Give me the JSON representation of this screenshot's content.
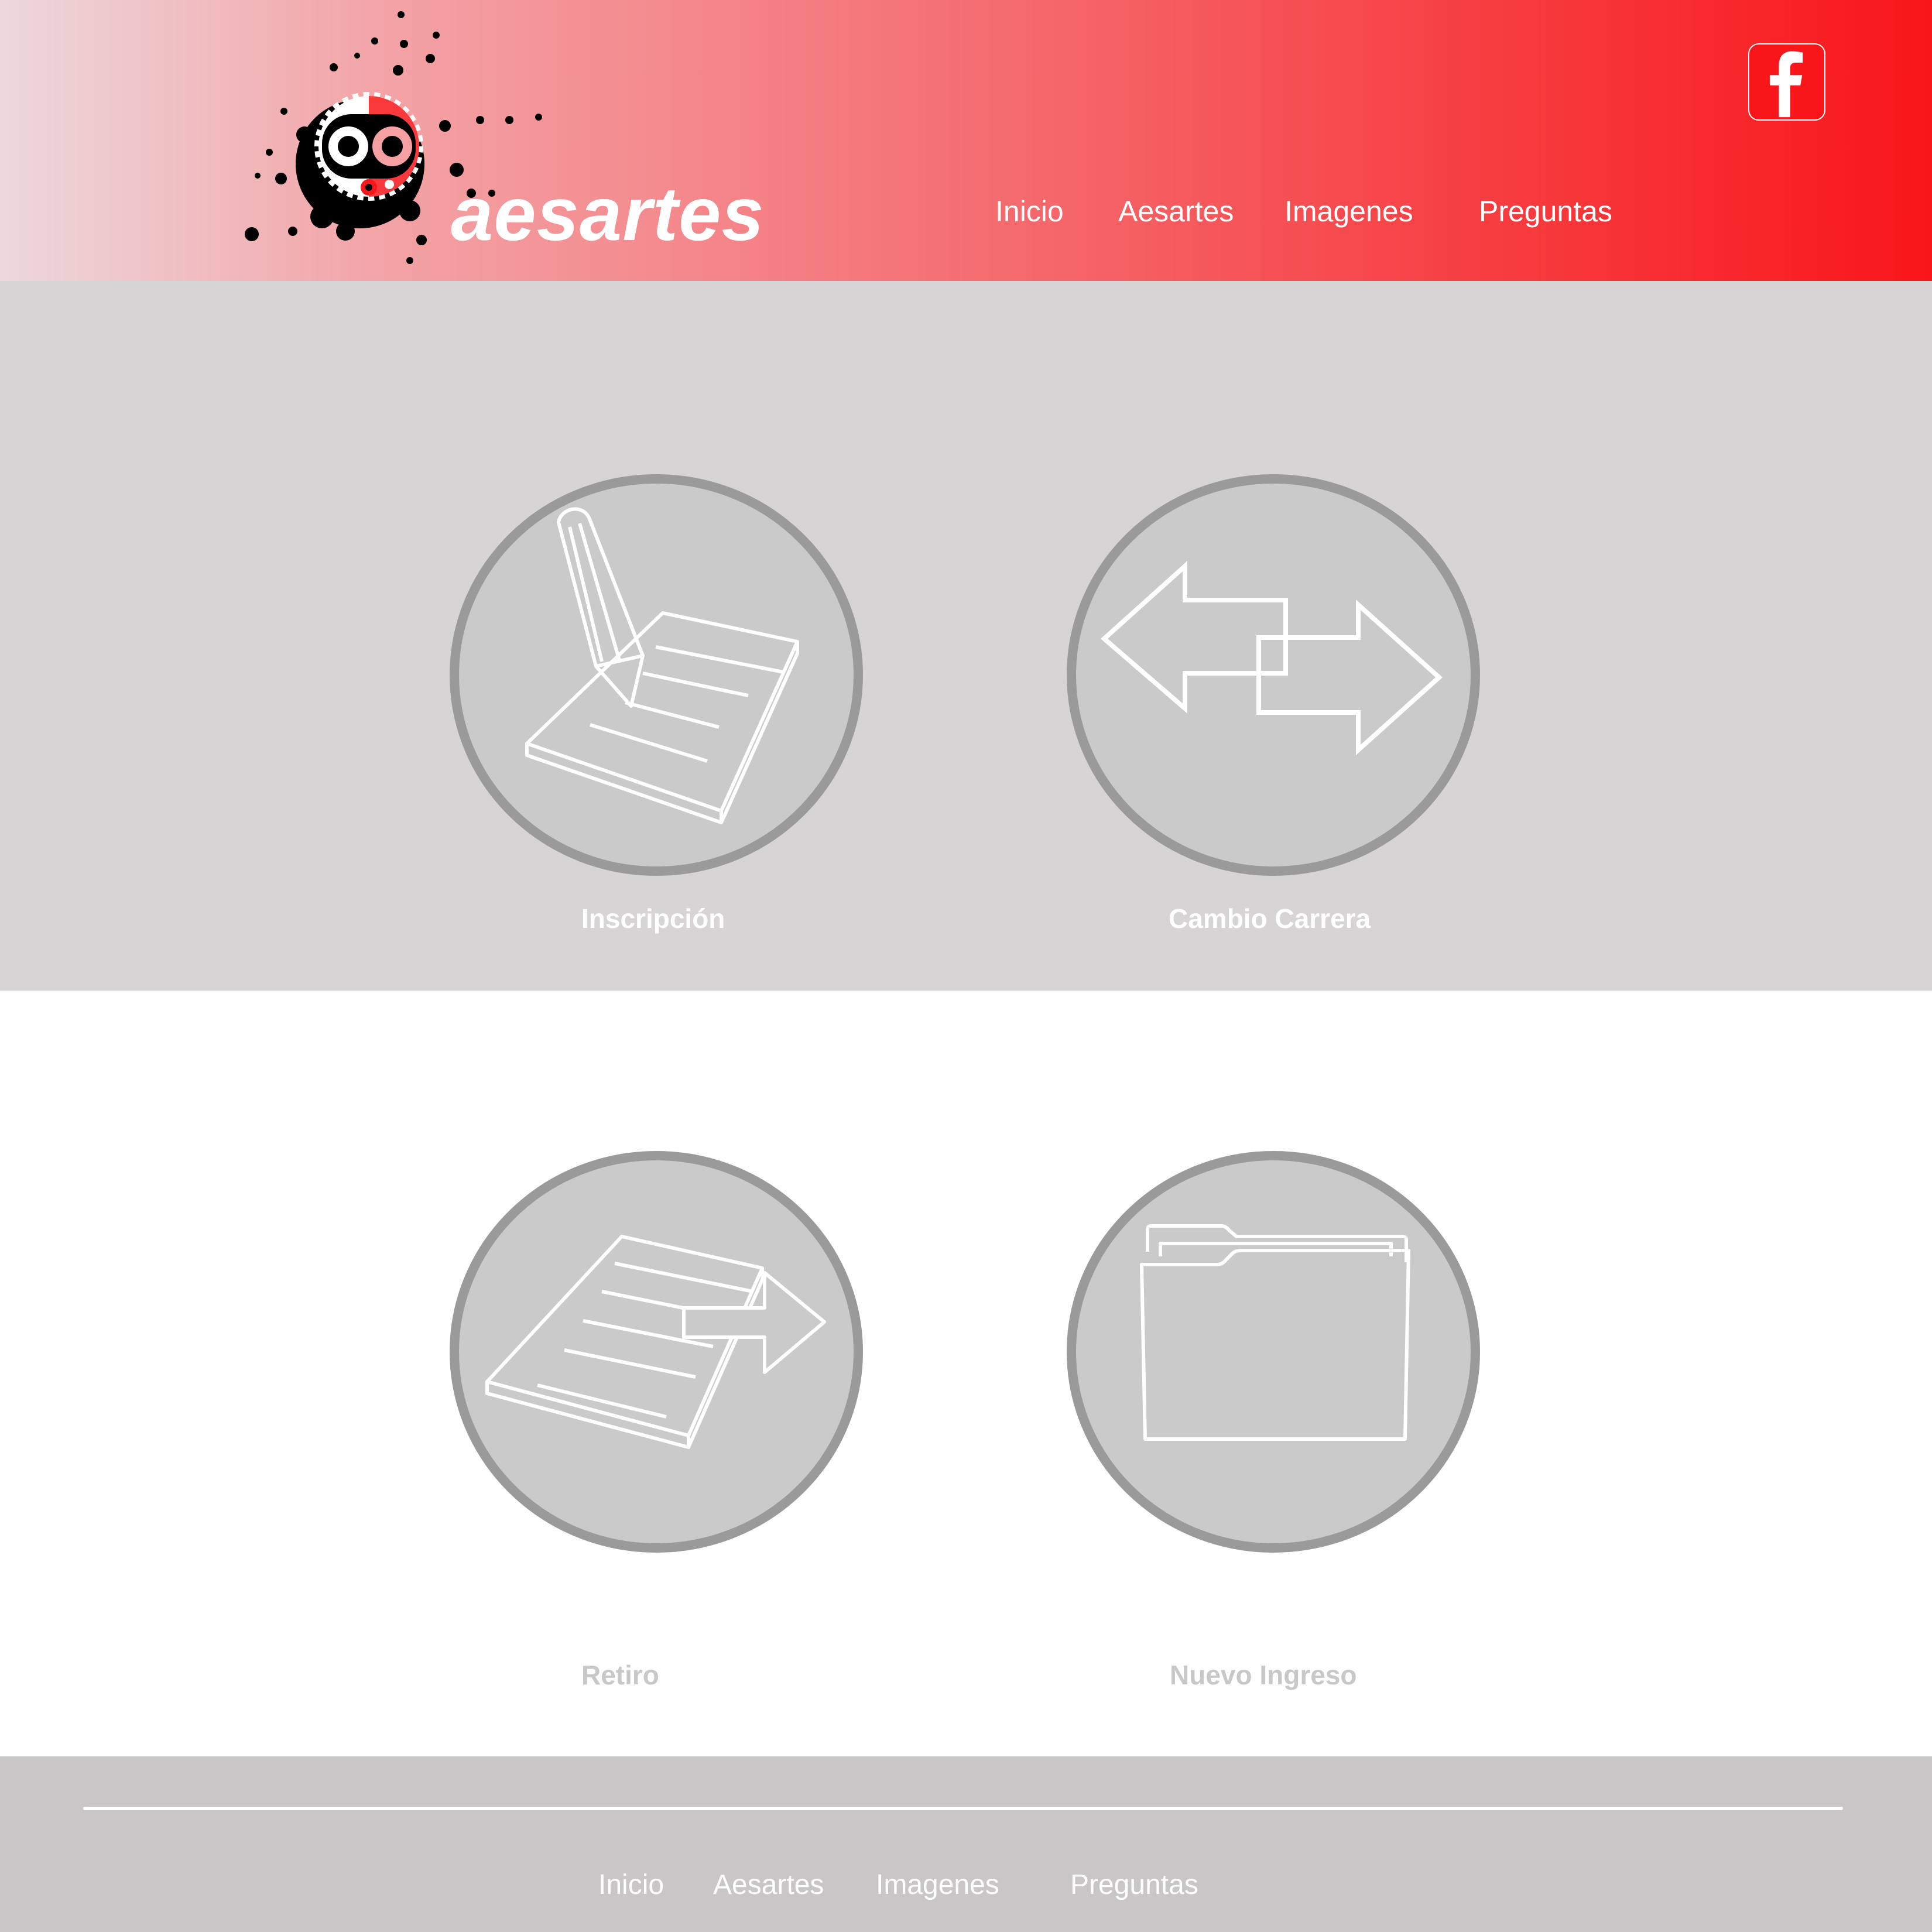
{
  "header": {
    "brand": "aesartes",
    "nav": [
      "Inicio",
      "Aesartes",
      "Imagenes",
      "Preguntas"
    ],
    "social_icon": "facebook-icon"
  },
  "tiles": [
    {
      "label": "Inscripción",
      "icon": "notepad-pencil-icon"
    },
    {
      "label": "Cambio Carrera",
      "icon": "swap-arrows-icon"
    },
    {
      "label": "Retiro",
      "icon": "notepad-arrow-icon"
    },
    {
      "label": "Nuevo Ingreso",
      "icon": "folder-icon"
    }
  ],
  "footer": {
    "nav": [
      "Inicio",
      "Aesartes",
      "Imagenes",
      "Preguntas"
    ]
  },
  "colors": {
    "header_gradient_start": "#ecd8dc",
    "header_gradient_end": "#f8161a",
    "top_section_bg": "#d7d4d5",
    "circle_fill": "#cacaca",
    "circle_stroke": "#9a9a9a",
    "footer_bg": "#c8c6c7"
  }
}
